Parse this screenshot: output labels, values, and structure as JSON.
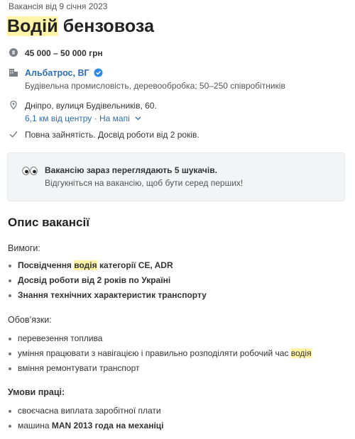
{
  "posted_date": "Вакансія від 9 січня 2023",
  "title": {
    "highlight": "Водій",
    "rest": " бензовоза"
  },
  "salary": "45 000 – 50 000 грн",
  "company": {
    "name": "Альбатрос, ВГ",
    "description": "Будівельна промисловість, деревообробка; 50–250 співробітників"
  },
  "location": {
    "address": "Дніпро, вулиця Будівельників, 60.",
    "distance": "6,1 км від центру",
    "separator": " · ",
    "map_link": "На мапі"
  },
  "employment": "Повна зайнятість. Досвід роботи від 2 років.",
  "notice": {
    "title": "Вакансію зараз переглядають 5 шукачів.",
    "subtitle": "Відгукніться на вакансію, щоб бути серед перших!"
  },
  "description": {
    "heading": "Опис вакансії",
    "requirements": {
      "label": "Вимоги:",
      "items": [
        {
          "before": "Посвідчення ",
          "highlight": "водія",
          "after": " категорії CE, ADR"
        },
        {
          "text": "Досвід роботи від 2 років по Україні"
        },
        {
          "text": "Знання технічних характеристик транспорту"
        }
      ]
    },
    "duties": {
      "label": "Обов’язки:",
      "items": [
        {
          "text": "перевезення топлива"
        },
        {
          "before": "уміння працювати з навігацією і правильно розподіляти робочий час ",
          "highlight": "водія",
          "after": ""
        },
        {
          "text": "вміння ремонтувати транспорт"
        }
      ]
    },
    "conditions": {
      "label": "Умови праці:",
      "items": [
        {
          "text": "своєчасна виплата заробітної плати"
        },
        {
          "normal": "машина ",
          "bold": "MAN 2013 года на механіці"
        }
      ]
    }
  },
  "colors": {
    "link": "#2f6db5",
    "highlight": "#fff3a8",
    "notice_bg": "#f3f4f5"
  }
}
